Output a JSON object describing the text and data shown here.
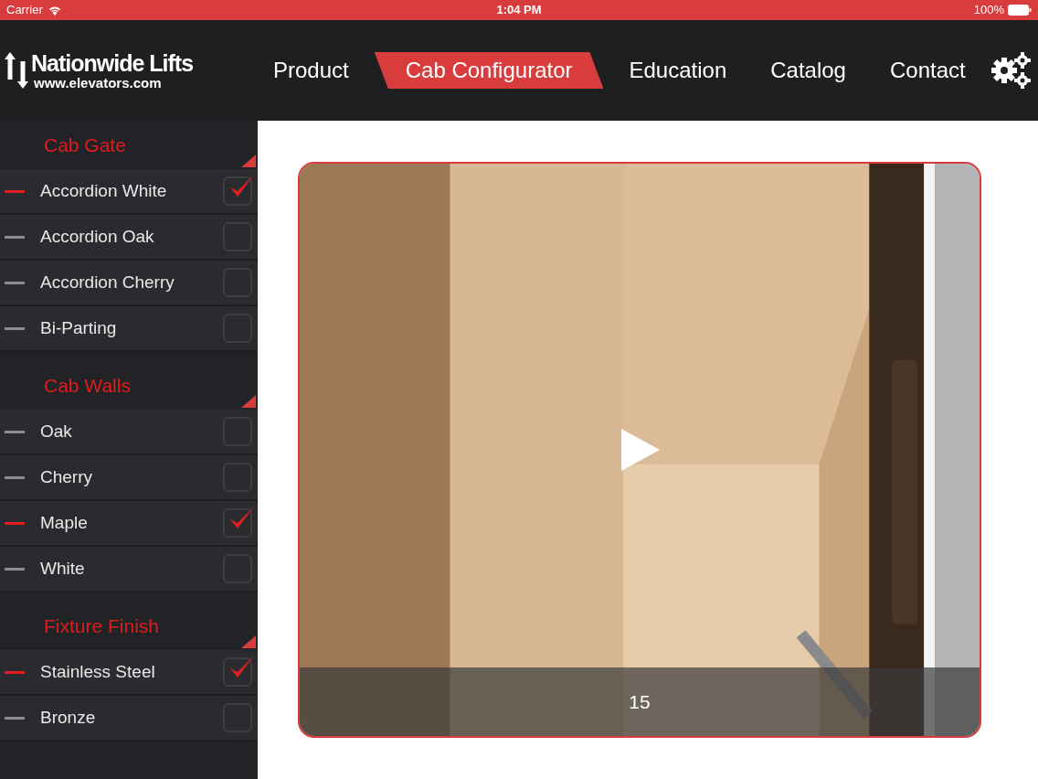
{
  "status_bar": {
    "carrier": "Carrier",
    "time": "1:04 PM",
    "battery": "100%"
  },
  "logo": {
    "name": "Nationwide Lifts",
    "url": "www.elevators.com"
  },
  "nav": [
    {
      "label": "Product",
      "selected": false
    },
    {
      "label": "Cab Configurator",
      "selected": true
    },
    {
      "label": "Education",
      "selected": false
    },
    {
      "label": "Catalog",
      "selected": false
    },
    {
      "label": "Contact",
      "selected": false
    }
  ],
  "sections": [
    {
      "title": "Cab Gate",
      "items": [
        {
          "label": "Accordion White",
          "checked": true
        },
        {
          "label": "Accordion Oak",
          "checked": false
        },
        {
          "label": "Accordion Cherry",
          "checked": false
        },
        {
          "label": "Bi-Parting",
          "checked": false
        }
      ]
    },
    {
      "title": "Cab Walls",
      "items": [
        {
          "label": "Oak",
          "checked": false
        },
        {
          "label": "Cherry",
          "checked": false
        },
        {
          "label": "Maple",
          "checked": true
        },
        {
          "label": "White",
          "checked": false
        }
      ]
    },
    {
      "title": "Fixture Finish",
      "items": [
        {
          "label": "Stainless Steel",
          "checked": true
        },
        {
          "label": "Bronze",
          "checked": false
        }
      ]
    }
  ],
  "video": {
    "kind": "picture",
    "caption": "15"
  }
}
